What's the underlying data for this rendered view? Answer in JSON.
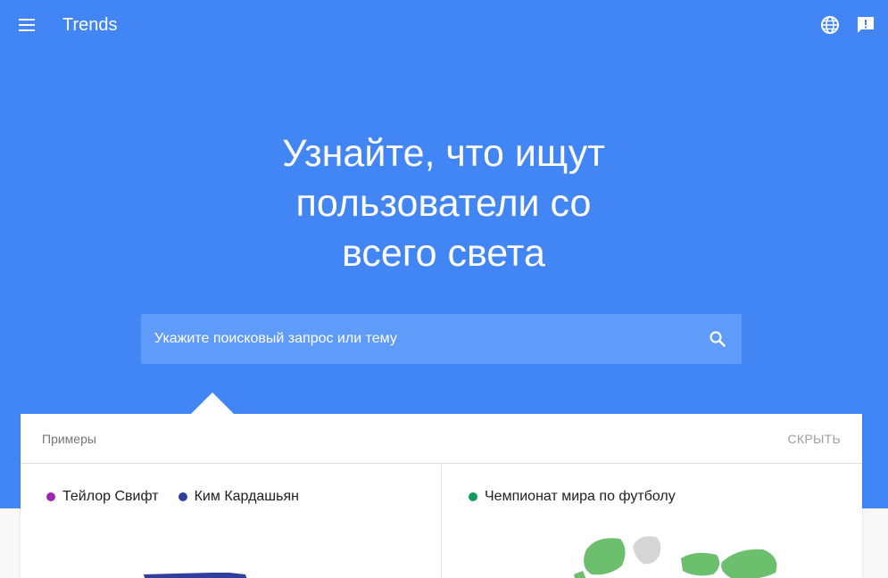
{
  "header": {
    "title": "Trends",
    "menu_icon": "menu-icon",
    "globe_icon": "globe-icon",
    "feedback_icon": "feedback-icon"
  },
  "hero": {
    "headline_lines": [
      "Узнайте, что ищут",
      "пользователи со",
      "всего света"
    ]
  },
  "search": {
    "placeholder": "Укажите поисковый запрос или тему",
    "value": "",
    "icon": "search-icon"
  },
  "examples": {
    "label": "Примеры",
    "hide_label": "СКРЫТЬ",
    "left_card": {
      "legend": [
        {
          "label": "Тейлор Свифт",
          "color": "#9c27b0"
        },
        {
          "label": "Ким Кардашьян",
          "color": "#303f9f"
        }
      ]
    },
    "right_card": {
      "legend": [
        {
          "label": "Чемпионат мира по футболу",
          "color": "#0f9d58"
        }
      ]
    }
  },
  "colors": {
    "hero_background": "#4285f4",
    "search_background": "#5f9bf8",
    "map_fill_left": "#303f9f",
    "map_fill_right": "#6cbf6c",
    "map_fill_grey": "#d6d6d6"
  }
}
